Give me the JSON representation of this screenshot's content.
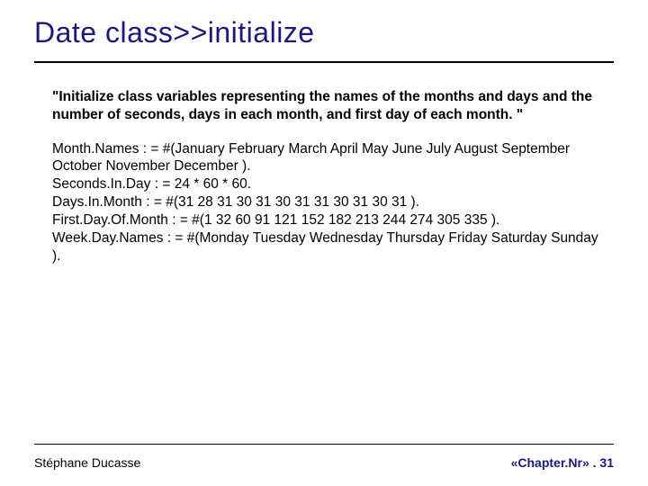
{
  "title": "Date class>>initialize",
  "comment": "\"Initialize class variables representing the names of the months and days and the number of seconds, days in each month, and first day of each month. \"",
  "code_lines": [
    "Month.Names  : = #(January February March April May June July August September October November December ).",
    "Seconds.In.Day : = 24 * 60 * 60.",
    "Days.In.Month : = #(31 28 31 30 31 30 31 31 30 31 30 31 ).",
    "First.Day.Of.Month : = #(1 32 60 91 121 152 182 213 244 274 305 335 ).",
    "Week.Day.Names : = #(Monday Tuesday Wednesday Thursday Friday Saturday Sunday )."
  ],
  "footer": {
    "left": "Stéphane Ducasse",
    "right": "«Chapter.Nr» . 31"
  }
}
